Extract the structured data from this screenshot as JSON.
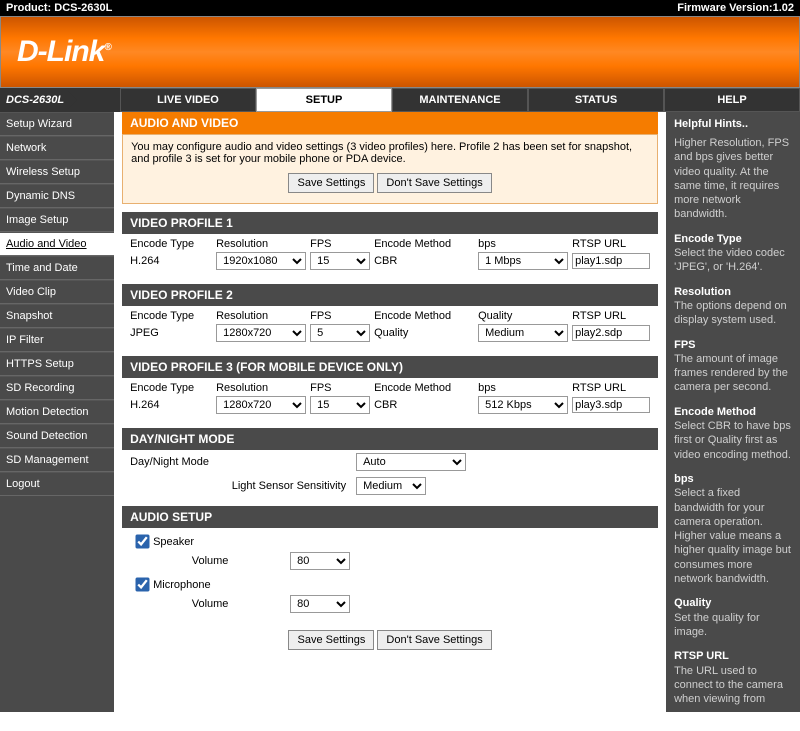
{
  "topbar": {
    "product_label": "Product: DCS-2630L",
    "firmware_label": "Firmware Version:1.02"
  },
  "brand": "D-Link",
  "model": "DCS-2630L",
  "tabs": {
    "live": "LIVE VIDEO",
    "setup": "SETUP",
    "maint": "MAINTENANCE",
    "status": "STATUS",
    "help": "HELP"
  },
  "sidebar": {
    "items": [
      "Setup Wizard",
      "Network",
      "Wireless Setup",
      "Dynamic DNS",
      "Image Setup",
      "Audio and Video",
      "Time and Date",
      "Video Clip",
      "Snapshot",
      "IP Filter",
      "HTTPS Setup",
      "SD Recording",
      "Motion Detection",
      "Sound Detection",
      "SD Management",
      "Logout"
    ],
    "active_index": 5
  },
  "intro": {
    "title": "AUDIO AND VIDEO",
    "text": "You may configure audio and video settings (3 video profiles) here. Profile 2 has been set for snapshot, and profile 3 is set for your mobile phone or PDA device.",
    "save": "Save Settings",
    "dont": "Don't Save Settings"
  },
  "profile_headers": {
    "encode": "Encode Type",
    "res": "Resolution",
    "fps": "FPS",
    "method": "Encode Method",
    "q": "Quality",
    "bps": "bps",
    "rtsp": "RTSP URL"
  },
  "p1": {
    "title": "VIDEO PROFILE 1",
    "encode": "H.264",
    "res": "1920x1080",
    "fps": "15",
    "method": "CBR",
    "bps": "1 Mbps",
    "rtsp": "play1.sdp"
  },
  "p2": {
    "title": "VIDEO PROFILE 2",
    "encode": "JPEG",
    "res": "1280x720",
    "fps": "5",
    "method": "Quality",
    "q": "Medium",
    "rtsp": "play2.sdp"
  },
  "p3": {
    "title": "VIDEO PROFILE 3 (FOR MOBILE DEVICE ONLY)",
    "encode": "H.264",
    "res": "1280x720",
    "fps": "15",
    "method": "CBR",
    "bps": "512 Kbps",
    "rtsp": "play3.sdp"
  },
  "daynight": {
    "title": "DAY/NIGHT MODE",
    "mode_label": "Day/Night Mode",
    "mode_val": "Auto",
    "sens_label": "Light Sensor Sensitivity",
    "sens_val": "Medium"
  },
  "audio": {
    "title": "AUDIO SETUP",
    "speaker": "Speaker",
    "mic": "Microphone",
    "volume": "Volume",
    "spk_vol": "80",
    "mic_vol": "80"
  },
  "hints": {
    "title": "Helpful Hints..",
    "intro": "Higher Resolution, FPS and bps gives better video quality. At the same time, it requires more network bandwidth.",
    "encode_h": "Encode Type",
    "encode_t": "Select the video codec 'JPEG', or 'H.264'.",
    "res_h": "Resolution",
    "res_t": "The options depend on display system used.",
    "fps_h": "FPS",
    "fps_t": "The amount of image frames rendered by the camera per second.",
    "method_h": "Encode Method",
    "method_t": "Select CBR to have bps first or Quality first as video encoding method.",
    "bps_h": "bps",
    "bps_t": "Select a fixed bandwidth for your camera operation. Higher value means a higher quality image but consumes more network bandwidth.",
    "q_h": "Quality",
    "q_t": "Set the quality for image.",
    "rtsp_h": "RTSP URL",
    "rtsp_t": "The URL used to connect to the camera when viewing from"
  }
}
